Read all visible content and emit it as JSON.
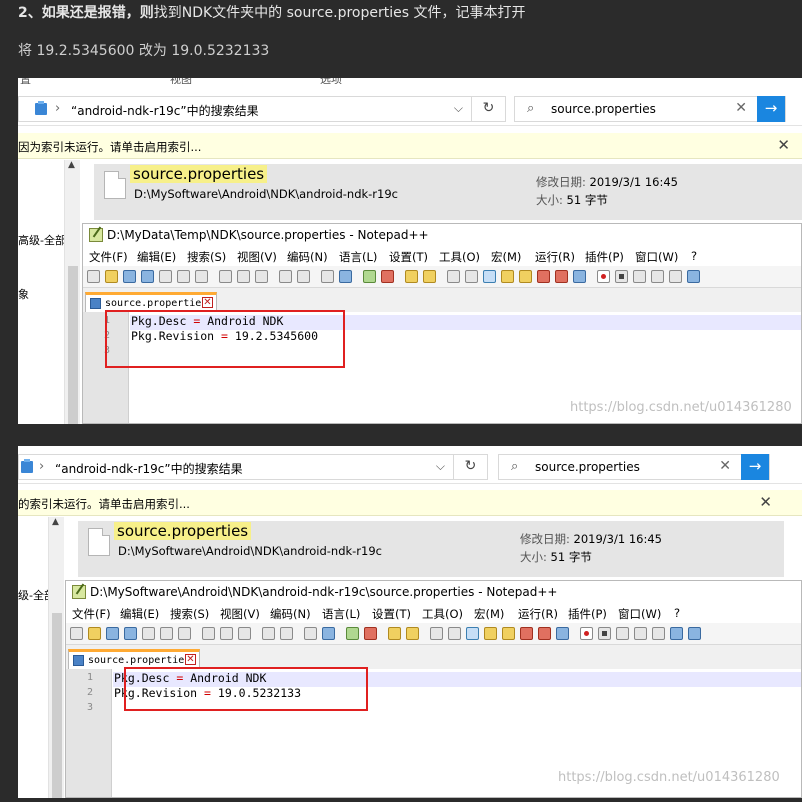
{
  "article": {
    "line1_num": "2、",
    "line1_bold1": "如果还是报错，",
    "line1_bold2": "则",
    "line1_rest": "找到NDK文件夹中的 source.properties 文件，记事本打开",
    "line2": "将 19.2.5345600 改为 19.0.5232133"
  },
  "shot1": {
    "menu_fragments": [
      "置",
      "视图",
      "选项"
    ],
    "explorer": {
      "breadcrumb": "“android-ndk-r19c”中的搜索结果",
      "search_query": "source.properties",
      "info_message": "因为索引未运行。请单击启用索引...",
      "left_label_1": "高级-全部",
      "left_label_2": "象",
      "file_name": "source.properties",
      "file_path": "D:\\MySoftware\\Android\\NDK\\android-ndk-r19c",
      "modified_label": "修改日期:",
      "modified_value": "2019/3/1 16:45",
      "size_label": "大小:",
      "size_value": "51 字节"
    },
    "notepad": {
      "title": "D:\\MyData\\Temp\\NDK\\source.properties - Notepad++",
      "tab_name": "source.properties",
      "line_numbers": [
        "1",
        "2",
        "3"
      ],
      "lines": [
        {
          "key": "Pkg.Desc",
          "eq": "=",
          "value": "Android NDK"
        },
        {
          "key": "Pkg.Revision",
          "eq": "=",
          "value": "19.2.5345600"
        }
      ]
    },
    "watermark": "https://blog.csdn.net/u014361280"
  },
  "shot2": {
    "explorer": {
      "breadcrumb": "“android-ndk-r19c”中的搜索结果",
      "search_query": "source.properties",
      "info_message": "的索引未运行。请单击启用索引...",
      "left_label_1": "级-全部",
      "file_name": "source.properties",
      "file_path": "D:\\MySoftware\\Android\\NDK\\android-ndk-r19c",
      "modified_label": "修改日期:",
      "modified_value": "2019/3/1 16:45",
      "size_label": "大小:",
      "size_value": "51 字节"
    },
    "notepad": {
      "title": "D:\\MySoftware\\Android\\NDK\\android-ndk-r19c\\source.properties - Notepad++",
      "tab_name": "source.properties",
      "line_numbers": [
        "1",
        "2",
        "3"
      ],
      "lines": [
        {
          "key": "Pkg.Desc",
          "eq": "=",
          "value": "Android NDK"
        },
        {
          "key": "Pkg.Revision",
          "eq": "=",
          "value": "19.0.5232133"
        }
      ]
    },
    "watermark": "https://blog.csdn.net/u014361280"
  },
  "notepad_menu": [
    "文件(F)",
    "编辑(E)",
    "搜索(S)",
    "视图(V)",
    "编码(N)",
    "语言(L)",
    "设置(T)",
    "工具(O)",
    "宏(M)",
    "运行(R)",
    "插件(P)",
    "窗口(W)",
    "?"
  ],
  "icons": {
    "folder": "folder-icon",
    "refresh": "refresh-icon",
    "search": "search-icon",
    "clear": "clear-icon",
    "go": "arrow-right-icon",
    "close": "close-icon",
    "file": "file-icon"
  }
}
